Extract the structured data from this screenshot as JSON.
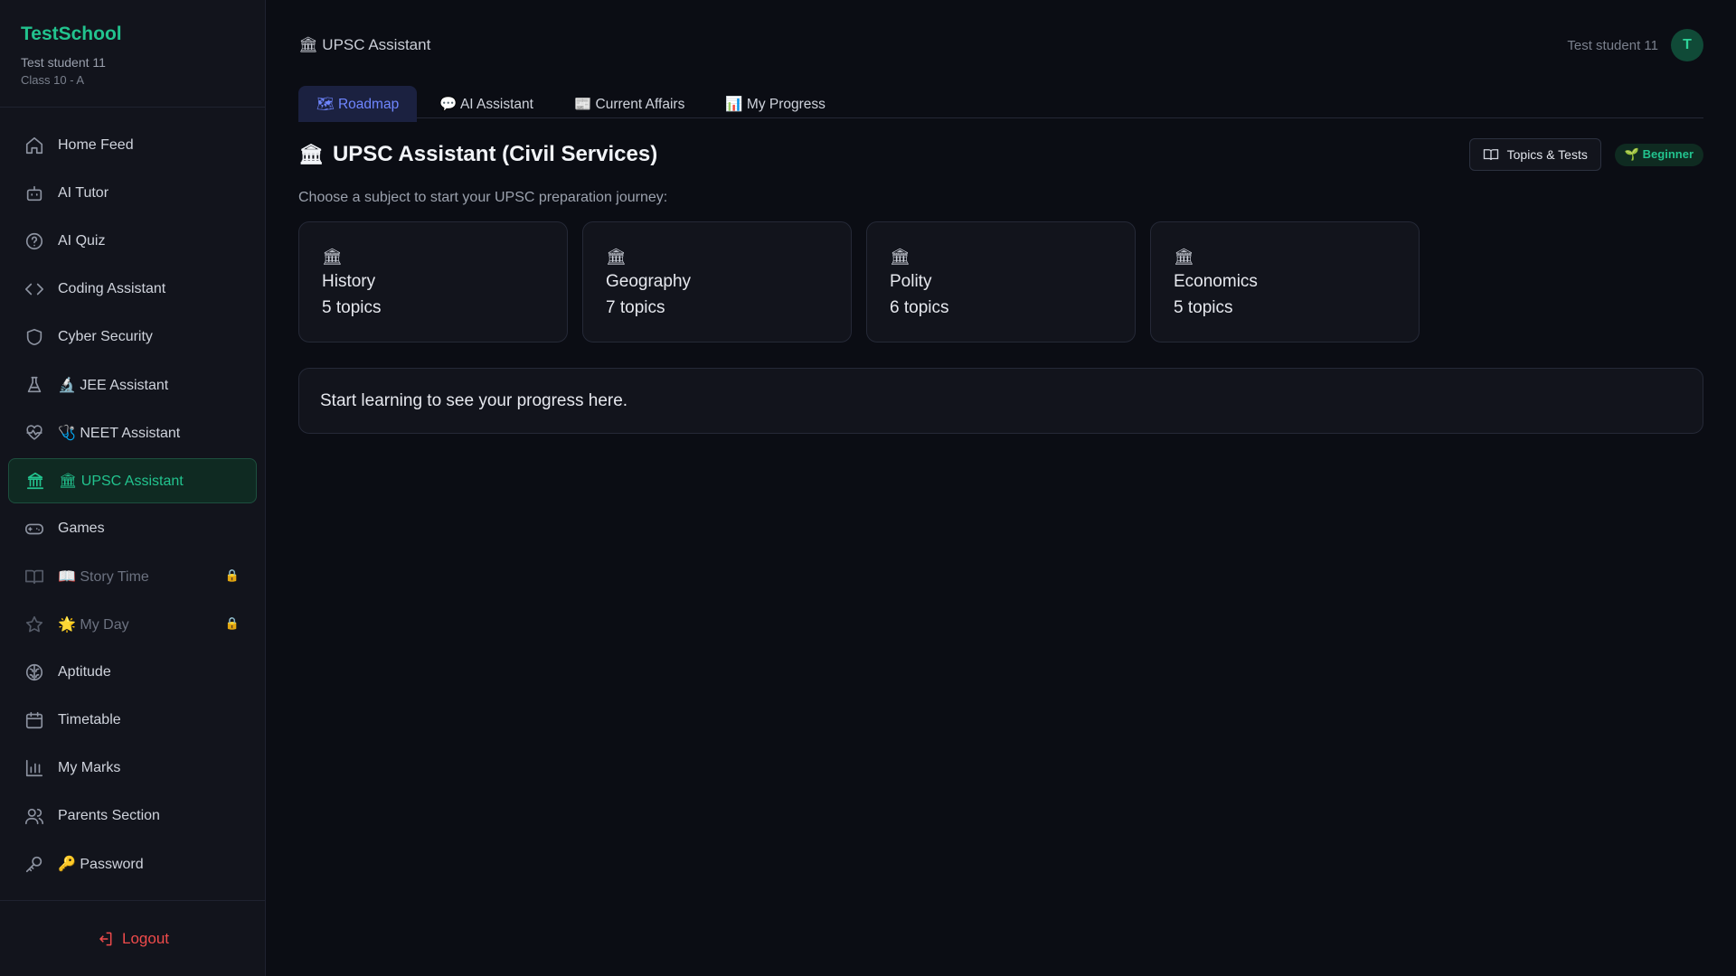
{
  "sidebar": {
    "brand": "TestSchool",
    "user_name": "Test student 11",
    "user_class": "Class 10 - A",
    "items": [
      {
        "label": "Home Feed",
        "icon": "home-icon"
      },
      {
        "label": "AI Tutor",
        "icon": "robot-icon"
      },
      {
        "label": "AI Quiz",
        "icon": "help-circle-icon"
      },
      {
        "label": "Coding Assistant",
        "icon": "code-icon"
      },
      {
        "label": "Cyber Security",
        "icon": "shield-icon"
      },
      {
        "label": "🔬 JEE Assistant",
        "icon": "flask-icon"
      },
      {
        "label": "🩺 NEET Assistant",
        "icon": "heart-pulse-icon"
      },
      {
        "label": "🏛 UPSC Assistant",
        "icon": "landmark-icon",
        "active": true
      },
      {
        "label": "Games",
        "icon": "gamepad-icon"
      },
      {
        "label": "📖 Story Time",
        "icon": "book-open-icon",
        "locked": true
      },
      {
        "label": "🌟 My Day",
        "icon": "star-icon",
        "locked": true
      },
      {
        "label": "Aptitude",
        "icon": "brain-icon"
      },
      {
        "label": "Timetable",
        "icon": "calendar-icon"
      },
      {
        "label": "My Marks",
        "icon": "bar-chart-icon"
      },
      {
        "label": "Parents Section",
        "icon": "users-icon"
      },
      {
        "label": "🔑 Password",
        "icon": "key-icon"
      }
    ],
    "logout_label": "Logout"
  },
  "header": {
    "breadcrumb": "🏛 UPSC Assistant",
    "user_name": "Test student 11",
    "avatar_initial": "T"
  },
  "tabs": [
    {
      "label": "🗺 Roadmap",
      "active": true
    },
    {
      "label": "💬 AI Assistant"
    },
    {
      "label": "📰 Current Affairs"
    },
    {
      "label": "📊 My Progress"
    }
  ],
  "page": {
    "title_icon": "🏛",
    "title": "UPSC Assistant (Civil Services)",
    "topics_button": "Topics & Tests",
    "level_badge": "🌱 Beginner",
    "subtitle": "Choose a subject to start your UPSC preparation journey:"
  },
  "subjects": [
    {
      "icon": "🏛",
      "name": "History",
      "topics": "5 topics"
    },
    {
      "icon": "🏛",
      "name": "Geography",
      "topics": "7 topics"
    },
    {
      "icon": "🏛",
      "name": "Polity",
      "topics": "6 topics"
    },
    {
      "icon": "🏛",
      "name": "Economics",
      "topics": "5 topics"
    }
  ],
  "progress_message": "Start learning to see your progress here.",
  "colors": {
    "accent": "#22c38e",
    "tab_active": "#6f86ff",
    "logout": "#ef4b4b"
  }
}
